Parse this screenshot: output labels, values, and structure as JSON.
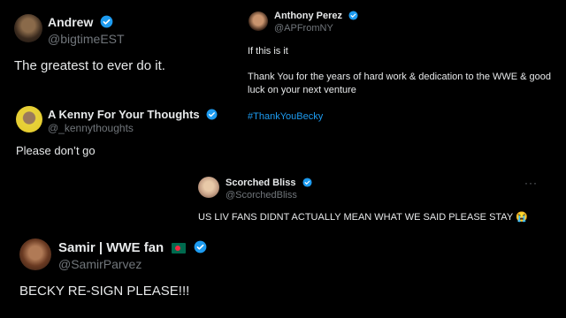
{
  "tweets": [
    {
      "name": "Andrew",
      "handle": "@bigtimeEST",
      "text": "The greatest to ever do it."
    },
    {
      "name": "Anthony Perez",
      "handle": "@APFromNY",
      "lines": [
        "If this is it",
        "Thank You for the years of hard work & dedication to the WWE & good",
        "luck on your next venture"
      ],
      "hashtag": "#ThankYouBecky"
    },
    {
      "name": "A Kenny For Your Thoughts",
      "handle": "@_kennythoughts",
      "text": "Please don’t go"
    },
    {
      "name": "Scorched Bliss",
      "handle": "@ScorchedBliss",
      "text": "US LIV FANS DIDNT ACTUALLY MEAN WHAT WE SAID PLEASE STAY 😭",
      "more": "···"
    },
    {
      "name": "Samir | WWE fan",
      "handle": "@SamirParvez",
      "text": "BECKY RE-SIGN PLEASE!!!"
    }
  ],
  "colors": {
    "background": "#000000",
    "verified": "#1d9bf0",
    "handle": "#71767b",
    "hashtag": "#1d9bf0"
  },
  "icons": [
    "verified-badge-icon",
    "bangladesh-flag-icon",
    "more-options-icon"
  ]
}
